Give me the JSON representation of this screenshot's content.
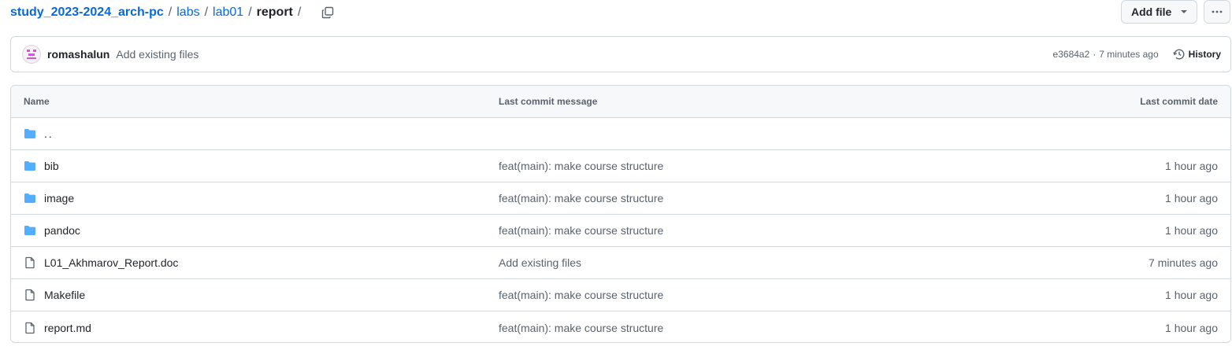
{
  "breadcrumb": {
    "repo": "study_2023-2024_arch-pc",
    "path1": "labs",
    "path2": "lab01",
    "current": "report",
    "sep": "/"
  },
  "actions": {
    "add_file_label": "Add file",
    "more_label": "···"
  },
  "commit": {
    "author": "romashalun",
    "message": "Add existing files",
    "hash": "e3684a2",
    "dot": "·",
    "time": "7 minutes ago",
    "history_label": "History"
  },
  "table": {
    "headers": {
      "name": "Name",
      "message": "Last commit message",
      "date": "Last commit date"
    },
    "rows": [
      {
        "type": "folder",
        "name": "..",
        "message": "",
        "date": ""
      },
      {
        "type": "folder",
        "name": "bib",
        "message": "feat(main): make course structure",
        "date": "1 hour ago"
      },
      {
        "type": "folder",
        "name": "image",
        "message": "feat(main): make course structure",
        "date": "1 hour ago"
      },
      {
        "type": "folder",
        "name": "pandoc",
        "message": "feat(main): make course structure",
        "date": "1 hour ago"
      },
      {
        "type": "file",
        "name": "L01_Akhmarov_Report.doc",
        "message": "Add existing files",
        "date": "7 minutes ago"
      },
      {
        "type": "file",
        "name": "Makefile",
        "message": "feat(main): make course structure",
        "date": "1 hour ago"
      },
      {
        "type": "file",
        "name": "report.md",
        "message": "feat(main): make course structure",
        "date": "1 hour ago"
      }
    ]
  },
  "colors": {
    "link": "#0969da",
    "folder": "#54aeff",
    "muted": "#59636e",
    "border": "#d1d9e0"
  }
}
